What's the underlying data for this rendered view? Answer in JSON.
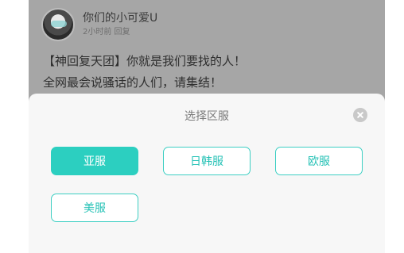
{
  "post": {
    "username": "你们的小可爱U",
    "time": "2小时前 回复",
    "lines": [
      "【神回复天团】你就是我们要找的人！",
      "全网最会说骚话的人们，请集结！"
    ]
  },
  "dialog": {
    "title": "选择区服",
    "close_icon": "close-circle-icon",
    "options": [
      {
        "label": "亚服",
        "selected": true
      },
      {
        "label": "日韩服",
        "selected": false
      },
      {
        "label": "欧服",
        "selected": false
      },
      {
        "label": "美服",
        "selected": false
      }
    ]
  },
  "colors": {
    "accent": "#2ccfc0",
    "overlay": "#a6a6a6",
    "sheet": "#f7f7f7"
  }
}
